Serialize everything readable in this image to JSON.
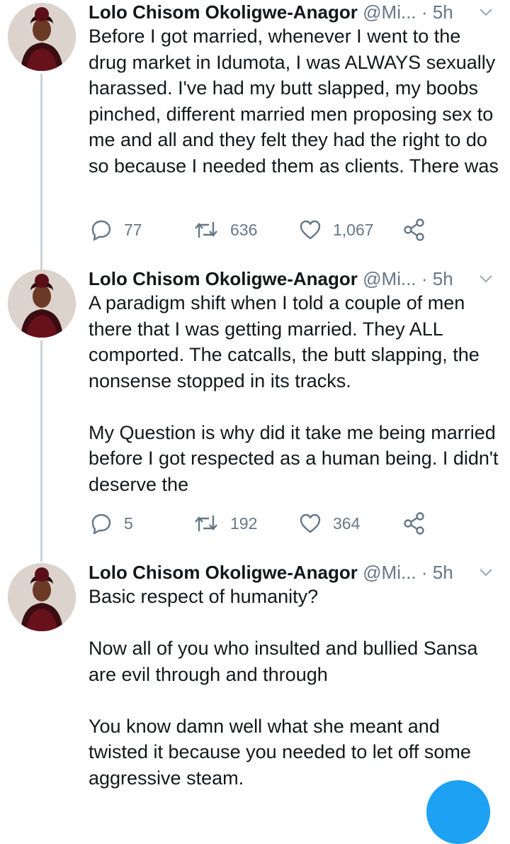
{
  "tweets": [
    {
      "name": "Lolo Chisom Okoligwe-Anagor",
      "handle": "@Mi...",
      "dot": "·",
      "time": "5h",
      "paragraphs": [
        "Before I got married, whenever I went to the drug market in Idumota, I was ALWAYS sexually harassed. I've had my butt slapped, my boobs pinched, different married men proposing sex to me and all and they felt they had the right to do so because I needed them as clients. There was"
      ],
      "replies": "77",
      "retweets": "636",
      "likes": "1,067"
    },
    {
      "name": "Lolo Chisom Okoligwe-Anagor",
      "handle": "@Mi...",
      "dot": "·",
      "time": "5h",
      "paragraphs": [
        "A paradigm shift when I told a couple of men there that I was getting married. They ALL comported. The catcalls, the butt slapping, the nonsense stopped in its tracks.",
        "My Question is why did it take me being married before I got respected as a human being. I didn't deserve the"
      ],
      "replies": "5",
      "retweets": "192",
      "likes": "364"
    },
    {
      "name": "Lolo Chisom Okoligwe-Anagor",
      "handle": "@Mi...",
      "dot": "·",
      "time": "5h",
      "paragraphs": [
        "Basic respect of humanity?",
        "Now all of you who insulted and bullied Sansa are evil through and through",
        "You know damn well what she meant and twisted it because you needed to let off some aggressive steam."
      ]
    }
  ],
  "colors": {
    "text": "#14171a",
    "muted": "#657786",
    "thread_line": "#c9d2d9",
    "accent": "#1da1f2"
  },
  "icons": [
    "reply-icon",
    "retweet-icon",
    "like-icon",
    "share-icon",
    "chevron-down-icon",
    "compose-button"
  ]
}
